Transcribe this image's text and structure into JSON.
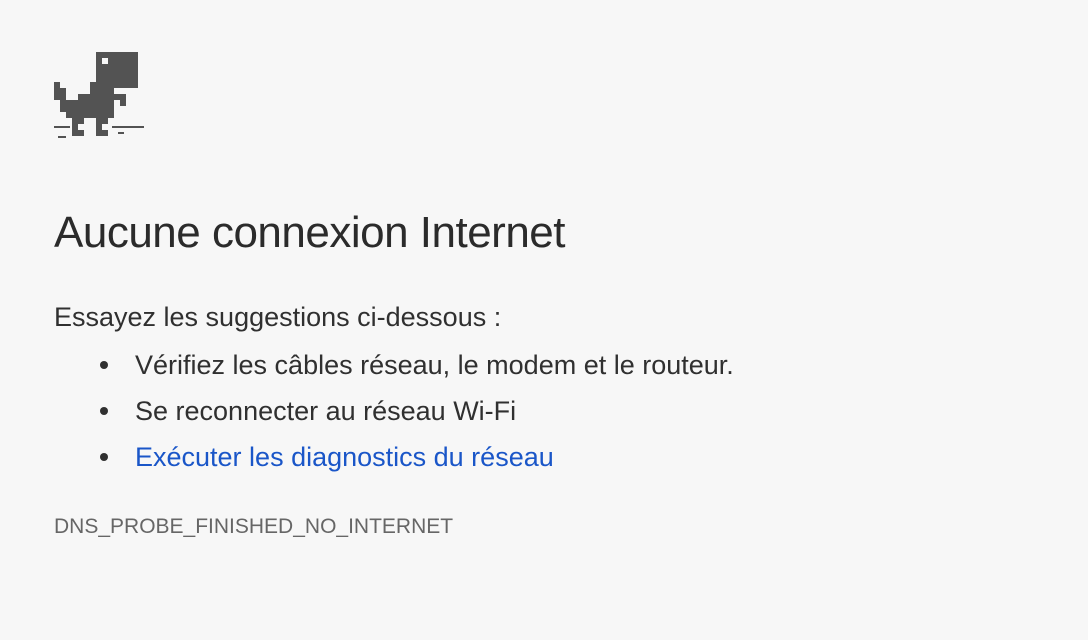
{
  "icon": "offline-dinosaur-icon",
  "colors": {
    "background": "#f7f7f7",
    "text": "#303030",
    "link": "#1a56c8",
    "error_code": "#666666",
    "dino": "#535353"
  },
  "error_page": {
    "title": "Aucune connexion Internet",
    "suggestions_heading": "Essayez les suggestions ci-dessous :",
    "suggestions": [
      "Vérifiez les câbles réseau, le modem et le routeur.",
      "Se reconnecter au réseau Wi-Fi"
    ],
    "diagnostics_link": "Exécuter les diagnostics du réseau",
    "error_code": "DNS_PROBE_FINISHED_NO_INTERNET"
  }
}
